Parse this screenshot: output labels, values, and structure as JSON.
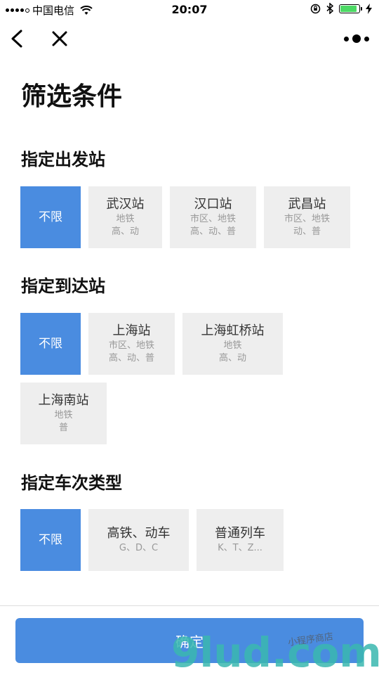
{
  "status_bar": {
    "carrier": "中国电信",
    "time": "20:07",
    "battery_level": 0.9
  },
  "page": {
    "title": "筛选条件"
  },
  "sections": [
    {
      "title": "指定出发站",
      "options": [
        {
          "label": "不限",
          "selected": true
        },
        {
          "label": "武汉站",
          "sub1": "地铁",
          "sub2": "高、动"
        },
        {
          "label": "汉口站",
          "sub1": "市区、地铁",
          "sub2": "高、动、普"
        },
        {
          "label": "武昌站",
          "sub1": "市区、地铁",
          "sub2": "动、普"
        }
      ]
    },
    {
      "title": "指定到达站",
      "options": [
        {
          "label": "不限",
          "selected": true
        },
        {
          "label": "上海站",
          "sub1": "市区、地铁",
          "sub2": "高、动、普"
        },
        {
          "label": "上海虹桥站",
          "sub1": "地铁",
          "sub2": "高、动"
        },
        {
          "label": "上海南站",
          "sub1": "地铁",
          "sub2": "普"
        }
      ]
    },
    {
      "title": "指定车次类型",
      "options": [
        {
          "label": "不限",
          "selected": true
        },
        {
          "label": "高铁、动车",
          "sub1": "G、D、C"
        },
        {
          "label": "普通列车",
          "sub1": "K、T、Z..."
        }
      ]
    }
  ],
  "confirm": {
    "label": "确定"
  },
  "watermark": {
    "text": "小程序商店",
    "brand": "9lud.com"
  },
  "colors": {
    "accent": "#4a8ce0",
    "option_bg": "#eeeeee",
    "battery": "#4cd964"
  }
}
